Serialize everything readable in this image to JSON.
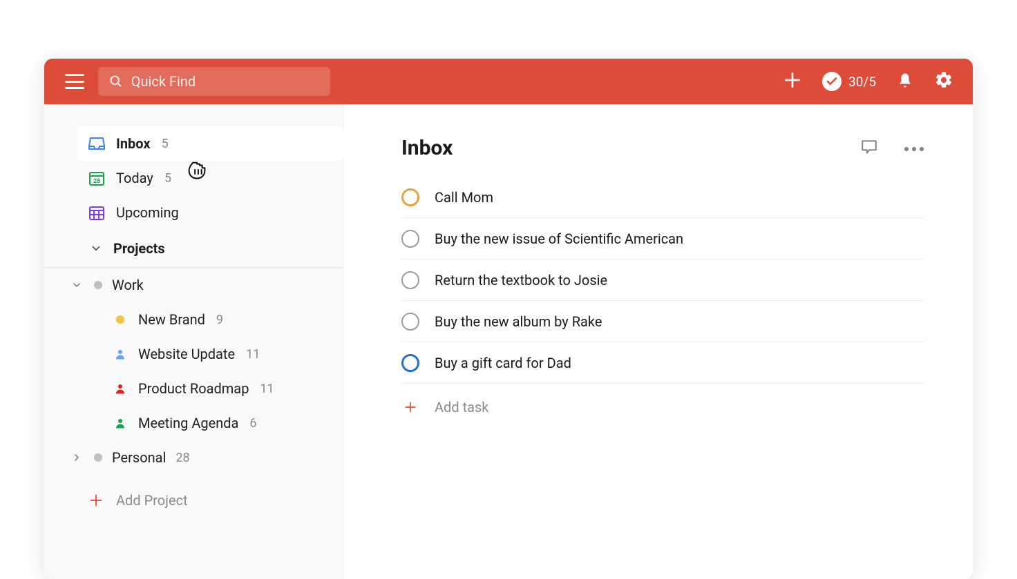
{
  "topbar": {
    "search_placeholder": "Quick Find",
    "karma": "30/5"
  },
  "sidebar": {
    "inbox_label": "Inbox",
    "inbox_count": "5",
    "today_label": "Today",
    "today_count": "5",
    "today_date": "28",
    "upcoming_label": "Upcoming",
    "projects_header": "Projects",
    "work_label": "Work",
    "work_children": {
      "new_brand_label": "New Brand",
      "new_brand_count": "9",
      "website_label": "Website Update",
      "website_count": "11",
      "roadmap_label": "Product Roadmap",
      "roadmap_count": "11",
      "meeting_label": "Meeting Agenda",
      "meeting_count": "6"
    },
    "personal_label": "Personal",
    "personal_count": "28",
    "add_project": "Add Project"
  },
  "main": {
    "title": "Inbox",
    "tasks": {
      "t1": "Call Mom",
      "t2": "Buy the new issue of Scientific American",
      "t3": "Return the textbook to Josie",
      "t4": "Buy the new album by Rake",
      "t5": "Buy a gift card for Dad"
    },
    "add_task": "Add task"
  }
}
